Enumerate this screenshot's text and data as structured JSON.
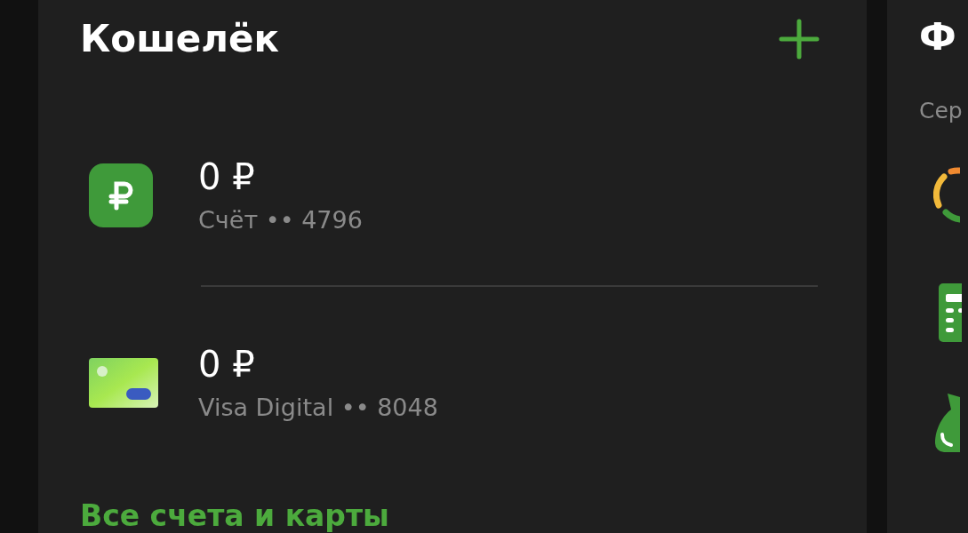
{
  "wallet": {
    "title": "Кошелёк",
    "accounts": [
      {
        "kind": "account",
        "amount": "0 ₽",
        "label": "Счёт •• 4796"
      },
      {
        "kind": "card",
        "amount": "0 ₽",
        "label": "Visa Digital •• 8048"
      }
    ],
    "link": "Все счета и карты"
  },
  "side_panel": {
    "title": "Ф",
    "subtitle": "Сер"
  }
}
